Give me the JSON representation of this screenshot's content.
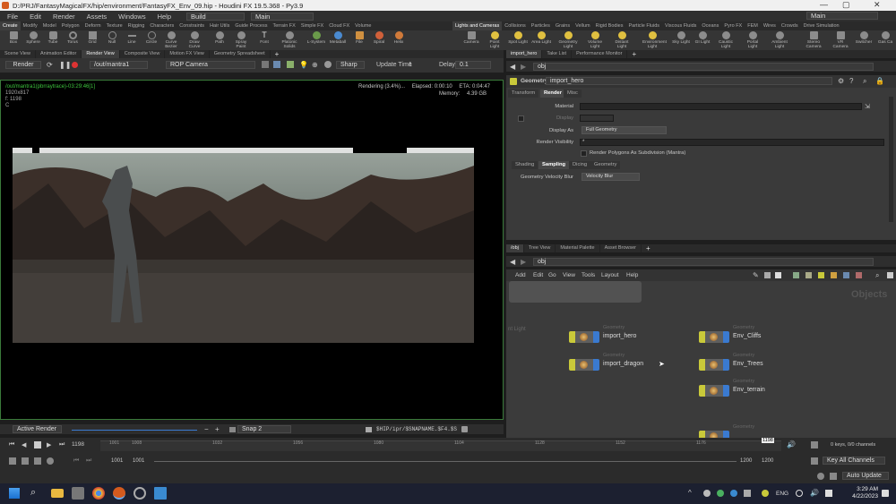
{
  "titlebar": {
    "title": "D:/PRJ/FantasyMagicalFX/hip/environment/FantasyFX_Env_09.hip - Houdini FX 19.5.368 - Py3.9",
    "min": "—",
    "max": "▢",
    "close": "✕"
  },
  "menubar": {
    "items": [
      "File",
      "Edit",
      "Render",
      "Assets",
      "Windows",
      "Help"
    ],
    "desktop": "Build",
    "desktop2": "Main",
    "right_desktop": "Main"
  },
  "shelf_left": {
    "tabs": [
      "Create",
      "Modify",
      "Model",
      "Polygon",
      "Deform",
      "Texture",
      "Rigging",
      "Characters",
      "Constraints",
      "Hair Utils",
      "Guide Process",
      "Terrain FX",
      "Simple FX",
      "Cloud FX",
      "Volume"
    ],
    "tools": [
      "Box",
      "Sphere",
      "Tube",
      "Torus",
      "Grid",
      "Null",
      "Line",
      "Circle",
      "Curve Bezier",
      "Draw Curve",
      "Path",
      "Spray Paint",
      "Font",
      "Platonic Solids",
      "L-System",
      "Metaball",
      "File",
      "Spiral",
      "Helix"
    ]
  },
  "shelf_right": {
    "tabs": [
      "Lights and Cameras",
      "Collisions",
      "Particles",
      "Grains",
      "Vellum",
      "Rigid Bodies",
      "Particle Fluids",
      "Viscous Fluids",
      "Oceans",
      "Pyro FX",
      "FEM",
      "Wires",
      "Crowds",
      "Drive Simulation"
    ],
    "tools": [
      "Camera",
      "Point Light",
      "Spot Light",
      "Area Light",
      "Geometry Light",
      "Volume Light",
      "Distant Light",
      "Environment Light",
      "Sky Light",
      "GI Light",
      "Caustic Light",
      "Portal Light",
      "Ambient Light",
      "Stereo Camera",
      "VR Camera",
      "Switcher",
      "Gas Ca"
    ]
  },
  "left_tabs": [
    "Scene View",
    "Animation Editor",
    "Render View",
    "Composite View",
    "Motion FX View",
    "Geometry Spreadsheet"
  ],
  "view_toolbar": {
    "render_label": "Render",
    "out_path": "/out/mantra1",
    "camera": "ROP Camera",
    "mode": "Sharp",
    "update_label": "Update Time",
    "update_value": "1",
    "delay_label": "Delay",
    "delay_value": "0.1"
  },
  "viewport": {
    "info_line1": "/out/mantra1(pbrraytrace)-03:29:46[1]",
    "info_line2": "1920x817",
    "info_line3": "f: 1198",
    "info_line4": "C",
    "status": "Rendering (3.4%)...",
    "elapsed": "Elapsed: 0:00:10",
    "eta": "ETA: 0:04:47",
    "memory_label": "Memory:",
    "memory": "4.39 GB"
  },
  "view_status": {
    "active_render": "Active Render",
    "snap": "Snap 2",
    "path": "$HIP/ipr/$SNAPNAME.$F4.$S"
  },
  "right_tabs1": [
    "import_hero",
    "Take List",
    "Performance Monitor"
  ],
  "path1": "obj",
  "param_header": {
    "type": "Geometry",
    "name": "import_hero"
  },
  "param_tabs": [
    "Transform",
    "Render",
    "Misc"
  ],
  "params": {
    "material": "Material",
    "display": "Display",
    "display_as": "Display As",
    "display_as_value": "Full Geometry",
    "render_visibility": "Render Visibility",
    "render_visibility_value": "*",
    "render_polys": "Render Polygons As Subdivision (Mantra)",
    "sub_tabs": [
      "Shading",
      "Sampling",
      "Dicing",
      "Geometry"
    ],
    "velocity_blur": "Geometry Velocity Blur",
    "velocity_blur_value": "Velocity Blur"
  },
  "right_tabs2": [
    "/obj",
    "Tree View",
    "Material Palette",
    "Asset Browser"
  ],
  "path2": "obj",
  "network_menu": [
    "Add",
    "Edit",
    "Go",
    "View",
    "Tools",
    "Layout",
    "Help"
  ],
  "network": {
    "context_label": "Objects",
    "fragment": "nt Light",
    "nodes": [
      {
        "type": "Geometry",
        "name": "import_hero"
      },
      {
        "type": "Geometry",
        "name": "import_dragon"
      },
      {
        "type": "Geometry",
        "name": "Env_Cliffs"
      },
      {
        "type": "Geometry",
        "name": "Env_Trees"
      },
      {
        "type": "Geometry",
        "name": "Env_terrain"
      },
      {
        "type": "Geometry",
        "name": ""
      }
    ]
  },
  "timeline": {
    "current_frame": "1198",
    "ticks": [
      "1001",
      "1008",
      "1032",
      "1056",
      "1080",
      "1104",
      "1128",
      "1152",
      "1176"
    ],
    "frame_marker": "1198",
    "keys": "0 keys, 0/0 channels",
    "key_all": "Key All Channels",
    "auto_update": "Auto Update"
  },
  "range": {
    "start": "1001",
    "start2": "1001",
    "end": "1200",
    "end2": "1200"
  },
  "taskbar": {
    "lang": "ENG",
    "time": "3:29 AM",
    "date": "4/22/2023"
  },
  "colors": {
    "accent": "#3a7ad0",
    "green_info": "#3dc43d",
    "node_yellow": "#c9c93a"
  }
}
